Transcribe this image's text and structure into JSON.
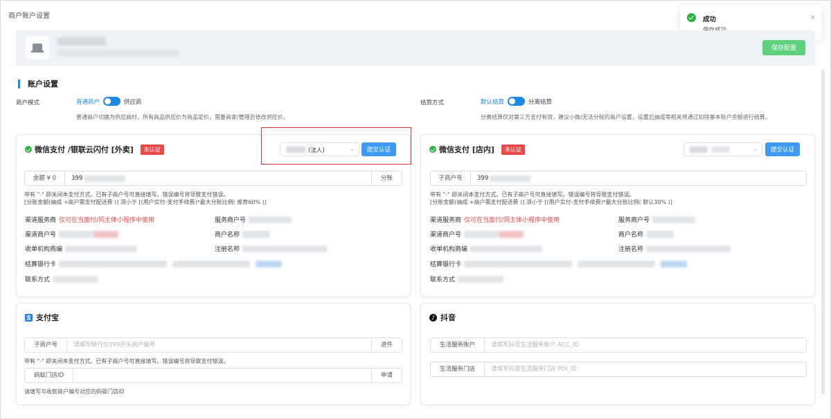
{
  "page_title": "商户账户设置",
  "toolbar": {
    "save_label": "保存配置"
  },
  "toast": {
    "title": "成功",
    "message": "保存成功",
    "close": "×"
  },
  "account": {
    "heading": "账户设置",
    "mode": {
      "label": "商户模式",
      "option_a": "普通商户",
      "option_b": "供应商",
      "hint": "普通商户切换为供应商时，所有商品供应价为商品定价，需要商家/管理员修改供应价。"
    },
    "settlement": {
      "label": "结算方式",
      "option_a": "默认结算",
      "option_b": "分离结算",
      "hint": "分离结算仅对第三方支付有效，建议小微/无法分账的商户设置，设置后抽成等相关将通过扣除基本账户余额进行结算。"
    }
  },
  "wx_takeout": {
    "title": "微信支付 /银联云闪付 [外卖]",
    "badge": "未认证",
    "select_value": "(法人)",
    "submit_label": "提交认证",
    "field_prefix": "余额 ¥ 0",
    "field_value": "399",
    "field_suffix": "分账",
    "note1": "带有 \"-\" 即关闭本支付方式。已有子商户号可直接填写。错误编号将导致支付错误。",
    "note2": "[分账金额(抽成 +商户需支付配送费 )] 须小于 [(用户实付-支付手续费)*最大分账比例( 推荐60% )]",
    "channel_label": "渠道服务商",
    "channel_value": "仅可在当面付/同主体小程序中使用",
    "service_no_label": "服务商户号",
    "channel_merchant_label": "渠道商户号",
    "merchant_name_label": "商户名称",
    "acq_label": "收单机构商编",
    "reg_name_label": "注册名称",
    "bank_label": "结算银行卡",
    "contact_label": "联系方式"
  },
  "wx_store": {
    "title": "微信支付 [店内]",
    "badge": "未认证",
    "submit_label": "提交认证",
    "field_prefix": "子商户号",
    "field_value": "399",
    "note1": "带有 \"-\" 即关闭本支付方式。已有子商户号可直接填写。错误编号将导致支付错误。",
    "note2": "[分账金额(抽成 +商户需支付配送费 )] 须小于 [(用户实付-支付手续费)*最大分账比例( 默认30% )]",
    "channel_label": "渠道服务商",
    "channel_value": "仅可在当面付/同主体小程序中使用",
    "service_no_label": "服务商户号",
    "channel_merchant_label": "渠道商户号",
    "merchant_name_label": "商户名称",
    "acq_label": "收单机构商编",
    "reg_name_label": "注册名称",
    "bank_label": "结算银行卡",
    "contact_label": "联系方式"
  },
  "alipay": {
    "title": "支付宝",
    "icon_glyph": "支",
    "sub_label": "子商户号",
    "sub_placeholder": "请填写随行付399开头商户编号",
    "sub_suffix": "进件",
    "note": "带有 \"-\" 即关闭本支付方式。已有子商户号可直接填写。错误编号将导致支付错误。",
    "store_label": "蚂蚁门店ID",
    "store_suffix": "申请",
    "store_note": "请填写与收款商户编号对应的蚂蚁门店ID"
  },
  "douyin": {
    "title": "抖音",
    "icon_glyph": "♪",
    "account_label": "生活服务账户",
    "account_placeholder": "请填写抖音生活服务账户 ACC_ID",
    "store_label": "生活服务门店",
    "store_placeholder": "请填写抖音生活服务门店 POI_ID"
  }
}
